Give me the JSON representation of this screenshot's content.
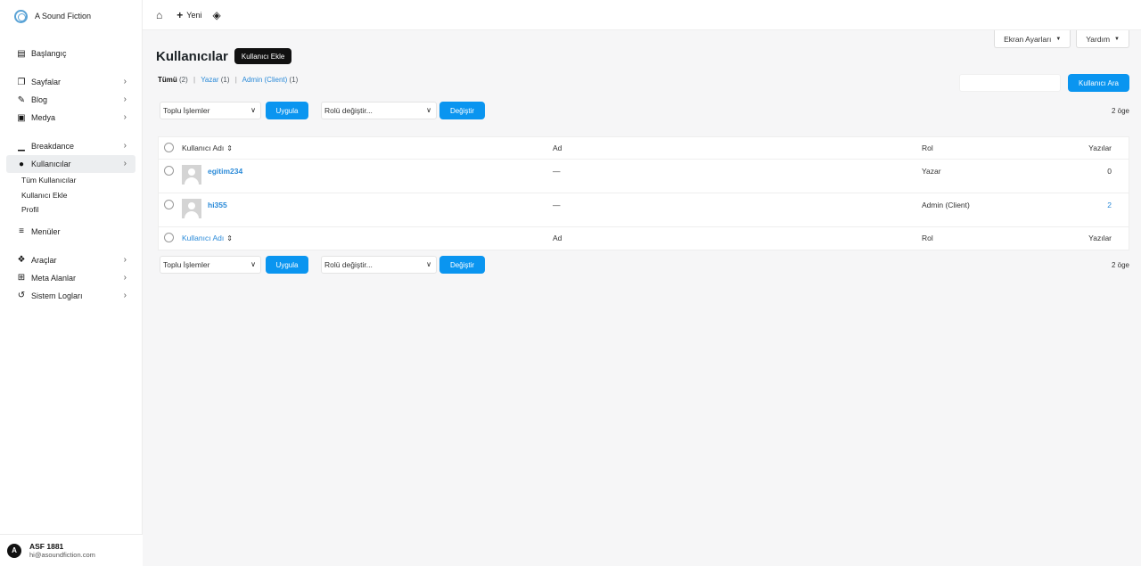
{
  "brand": {
    "name": "A Sound Fiction"
  },
  "sidebar": {
    "items": [
      {
        "label": "Başlangıç",
        "icon": "dashboard-icon"
      },
      {
        "label": "Sayfalar",
        "icon": "pages-icon"
      },
      {
        "label": "Blog",
        "icon": "blog-icon"
      },
      {
        "label": "Medya",
        "icon": "media-icon"
      },
      {
        "label": "Breakdance",
        "icon": "breakdance-icon"
      },
      {
        "label": "Kullanıcılar",
        "icon": "users-icon"
      },
      {
        "label": "Menüler",
        "icon": "menu-icon"
      },
      {
        "label": "Araçlar",
        "icon": "wrench-icon"
      },
      {
        "label": "Meta Alanlar",
        "icon": "table-icon"
      },
      {
        "label": "Sistem Logları",
        "icon": "history-icon"
      }
    ],
    "users_sub": [
      "Tüm Kullanıcılar",
      "Kullanıcı Ekle",
      "Profil"
    ],
    "user": {
      "avatar_letter": "A",
      "name": "ASF 1881",
      "email": "hi@asoundfiction.com"
    }
  },
  "topbar": {
    "new_label": "Yeni"
  },
  "screen_options": {
    "screen_label": "Ekran Ayarları",
    "help_label": "Yardım"
  },
  "page": {
    "title": "Kullanıcılar",
    "add_label": "Kullanıcı Ekle"
  },
  "filters": [
    {
      "label": "Tümü",
      "count": "(2)"
    },
    {
      "label": "Yazar",
      "count": "(1)"
    },
    {
      "label": "Admin (Client)",
      "count": "(1)"
    }
  ],
  "search": {
    "placeholder": "",
    "button_label": "Kullanıcı Ara"
  },
  "tablenav": {
    "bulk_label": "Toplu İşlemler",
    "apply_label": "Uygula",
    "role_label": "Rolü değiştir...",
    "change_label": "Değiştir",
    "count": "2 öge"
  },
  "table": {
    "columns": {
      "username": "Kullanıcı Adı",
      "name": "Ad",
      "role": "Rol",
      "posts": "Yazılar"
    },
    "rows": [
      {
        "username": "egitim234",
        "name": "—",
        "role": "Yazar",
        "posts": "0"
      },
      {
        "username": "hi355",
        "name": "—",
        "role": "Admin (Client)",
        "posts": "2"
      }
    ]
  },
  "colors": {
    "accent": "#0a95f0",
    "link": "#2a8ad8"
  }
}
